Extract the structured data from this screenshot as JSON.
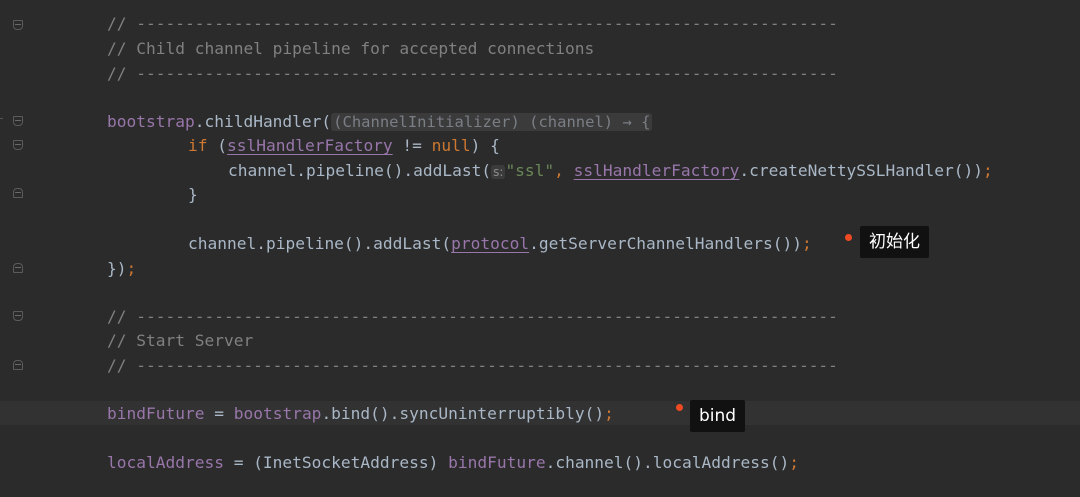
{
  "editor": {
    "lines": {
      "l1_comment": "// ------------------------------------------------------------------------",
      "l2_comment": "// Child channel pipeline for accepted connections",
      "l3_comment": "// ------------------------------------------------------------------------",
      "l5_obj": "bootstrap",
      "l5_call": ".childHandler(",
      "l5_hint": "(ChannelInitializer) (channel) → {",
      "l6_if": "if",
      "l6_open": " (",
      "l6_field": "sslHandlerFactory",
      "l6_neq": " != ",
      "l6_null": "null",
      "l6_close": ") {",
      "l7_call": "channel.pipeline().addLast(",
      "l7_hint_s": "s:",
      "l7_str": "\"ssl\"",
      "l7_comma": ", ",
      "l7_field": "sslHandlerFactory",
      "l7_rest": ".createNettySSLHandler())",
      "l7_semi": ";",
      "l8_brace": "}",
      "l10_call": "channel.pipeline().addLast(",
      "l10_field": "protocol",
      "l10_rest": ".getServerChannelHandlers())",
      "l10_semi": ";",
      "l11_close": "})",
      "l11_semi": ";",
      "l13_comment": "// ------------------------------------------------------------------------",
      "l14_comment": "// Start Server",
      "l15_comment": "// ------------------------------------------------------------------------",
      "l17_field1": "bindFuture",
      "l17_eq": " = ",
      "l17_field2": "bootstrap",
      "l17_rest": ".bind().syncUninterruptibly()",
      "l17_semi": ";",
      "l19_field1": "localAddress",
      "l19_mid": " = (InetSocketAddress) ",
      "l19_field2": "bindFuture",
      "l19_rest": ".channel().localAddress()",
      "l19_semi": ";"
    }
  },
  "annotations": {
    "init_label": "初始化",
    "bind_label": "bind"
  },
  "colors": {
    "background": "#2b2b2b",
    "comment": "#808080",
    "field": "#9876aa",
    "keyword": "#cc7832",
    "string": "#6a8759",
    "default": "#a9b7c6",
    "annotation_dot": "#f04a23",
    "annotation_bg": "#111111"
  }
}
